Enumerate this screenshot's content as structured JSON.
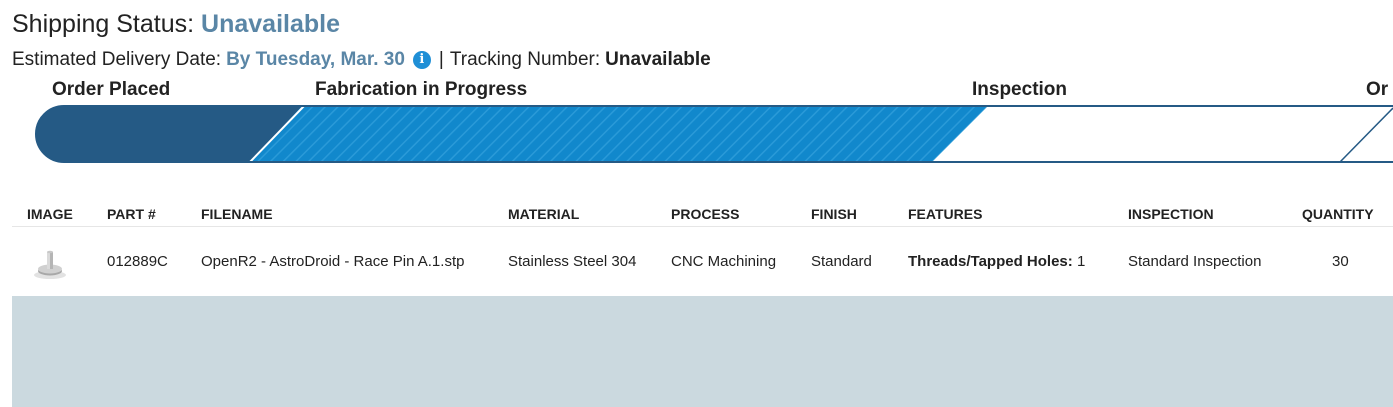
{
  "header": {
    "label": "Shipping Status:",
    "status": "Unavailable",
    "delivery_label": "Estimated Delivery Date:",
    "delivery_date": "By Tuesday, Mar. 30",
    "info_icon": "info-icon",
    "separator": "|",
    "tracking_label": "Tracking Number:",
    "tracking_value": "Unavailable"
  },
  "stages": [
    {
      "label": "Order Placed"
    },
    {
      "label": "Fabrication in Progress"
    },
    {
      "label": "Inspection"
    },
    {
      "label": "Or"
    }
  ],
  "progress_colors": {
    "completed": "#255a85",
    "in_progress": "#1188cc",
    "pending": "#ffffff",
    "border": "#255a85"
  },
  "table": {
    "columns": [
      "IMAGE",
      "PART #",
      "FILENAME",
      "MATERIAL",
      "PROCESS",
      "FINISH",
      "FEATURES",
      "INSPECTION",
      "QUANTITY"
    ],
    "rows": [
      {
        "image": "part-thumbnail-icon",
        "part_number": "012889C",
        "filename": "OpenR2 - AstroDroid - Race Pin A.1.stp",
        "material": "Stainless Steel 304",
        "process": "CNC Machining",
        "finish": "Standard",
        "features_label": "Threads/Tapped Holes:",
        "features_value": "1",
        "inspection": "Standard Inspection",
        "quantity": "30"
      }
    ]
  }
}
